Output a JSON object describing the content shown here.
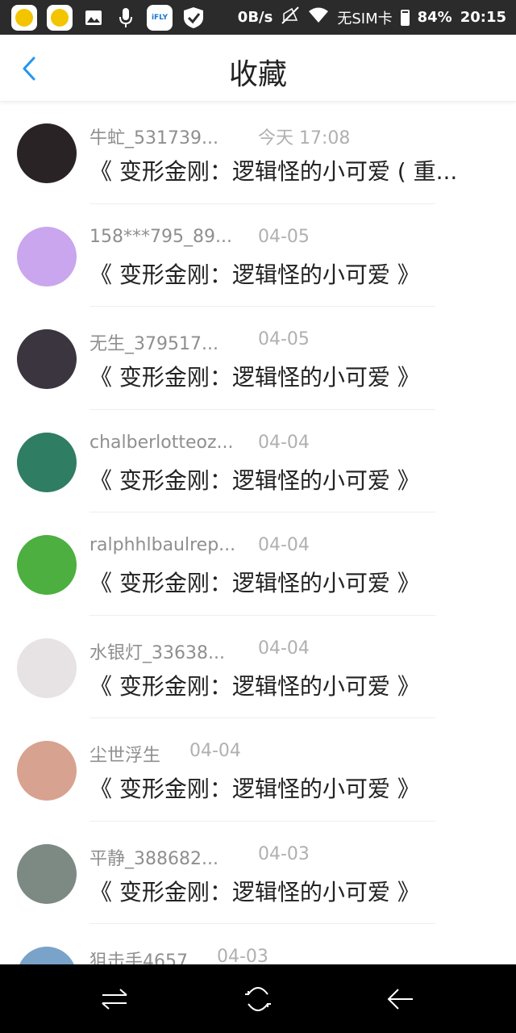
{
  "status_bar": {
    "speed": "0B/s",
    "sim": "无SIM卡",
    "battery": "84%",
    "battery_level": 0.84,
    "time": "20:15",
    "ifly_label": "iFLY"
  },
  "header": {
    "title": "收藏"
  },
  "items": [
    {
      "name": "牛虻_531739...",
      "time": "今天 17:08",
      "content": "《 变形金刚：逻辑怪的小可爱 ( 重...",
      "avatar_color": "#2a2326"
    },
    {
      "name": "158***795_89...",
      "time": "04-05",
      "content": "《 变形金刚：逻辑怪的小可爱 》",
      "avatar_color": "#c9a6ee"
    },
    {
      "name": "无生_379517...",
      "time": "04-05",
      "content": "《 变形金刚：逻辑怪的小可爱 》",
      "avatar_color": "#3b3540"
    },
    {
      "name": "chalberlotteoz...",
      "time": "04-04",
      "content": "《 变形金刚：逻辑怪的小可爱 》",
      "avatar_color": "#2f7d63"
    },
    {
      "name": "ralphhlbaulrep...",
      "time": "04-04",
      "content": "《 变形金刚：逻辑怪的小可爱 》",
      "avatar_color": "#4caf3f"
    },
    {
      "name": "水银灯_33638...",
      "time": "04-04",
      "content": "《 变形金刚：逻辑怪的小可爱 》",
      "avatar_color": "#e7e2e4"
    },
    {
      "name": "尘世浮生",
      "time": "04-04",
      "content": "《 变形金刚：逻辑怪的小可爱 》",
      "avatar_color": "#d8a290"
    },
    {
      "name": "平静_388682...",
      "time": "04-03",
      "content": "《 变形金刚：逻辑怪的小可爱 》",
      "avatar_color": "#7d8a84"
    },
    {
      "name": "狙击手4657",
      "time": "04-03",
      "content": "",
      "avatar_color": "#7aa3c9"
    }
  ],
  "colors": {
    "accent": "#2196f3",
    "status_bar": "#2b2b2b",
    "nav_bar": "#000000"
  }
}
